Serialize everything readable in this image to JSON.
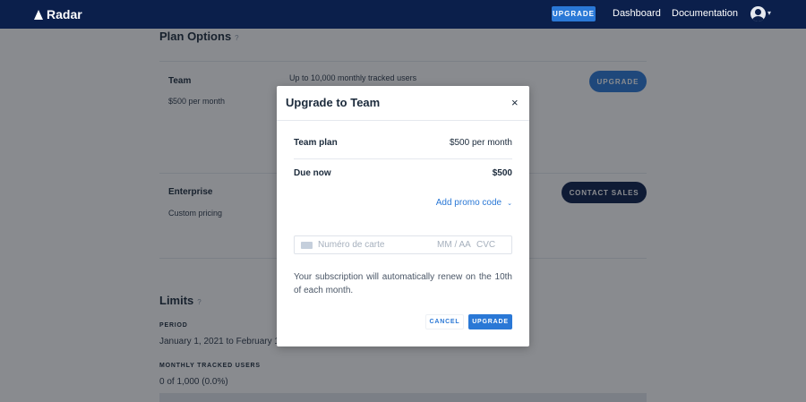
{
  "nav": {
    "brand": "Radar",
    "upgrade_label": "UPGRADE",
    "links": [
      "Dashboard",
      "Documentation"
    ]
  },
  "plan_options": {
    "title": "Plan Options",
    "help": "?",
    "team": {
      "name": "Team",
      "price": "$500 per month",
      "feature": "Up to 10,000 monthly tracked users",
      "button": "UPGRADE"
    },
    "enterprise": {
      "name": "Enterprise",
      "price": "Custom pricing",
      "button": "CONTACT SALES"
    }
  },
  "limits": {
    "title": "Limits",
    "help": "?",
    "period_label": "PERIOD",
    "period_value": "January 1, 2021 to February 1, 2",
    "mtu_label": "MONTHLY TRACKED USERS",
    "mtu_value": "0 of 1,000 (0.0%)",
    "mtu_fraction": 0.0
  },
  "modal": {
    "title": "Upgrade to Team",
    "close": "×",
    "plan_label": "Team plan",
    "plan_value": "$500 per month",
    "due_label": "Due now",
    "due_value": "$500",
    "promo_label": "Add promo code",
    "promo_caret": "⌄",
    "card_number_placeholder": "Numéro de carte",
    "card_expiry_placeholder": "MM / AA",
    "card_cvc_placeholder": "CVC",
    "renew_text": "Your subscription will automatically renew on the 10th of each month.",
    "cancel_label": "CANCEL",
    "upgrade_label": "UPGRADE"
  },
  "colors": {
    "nav_bg": "#0b1f4b",
    "accent": "#2a78d6",
    "overlay": "rgba(20,24,32,0.5)"
  },
  "icons": {
    "logo": "radar-logo-icon",
    "avatar": "user-avatar-icon",
    "close": "close-icon",
    "card": "credit-card-icon",
    "help": "help-icon"
  }
}
